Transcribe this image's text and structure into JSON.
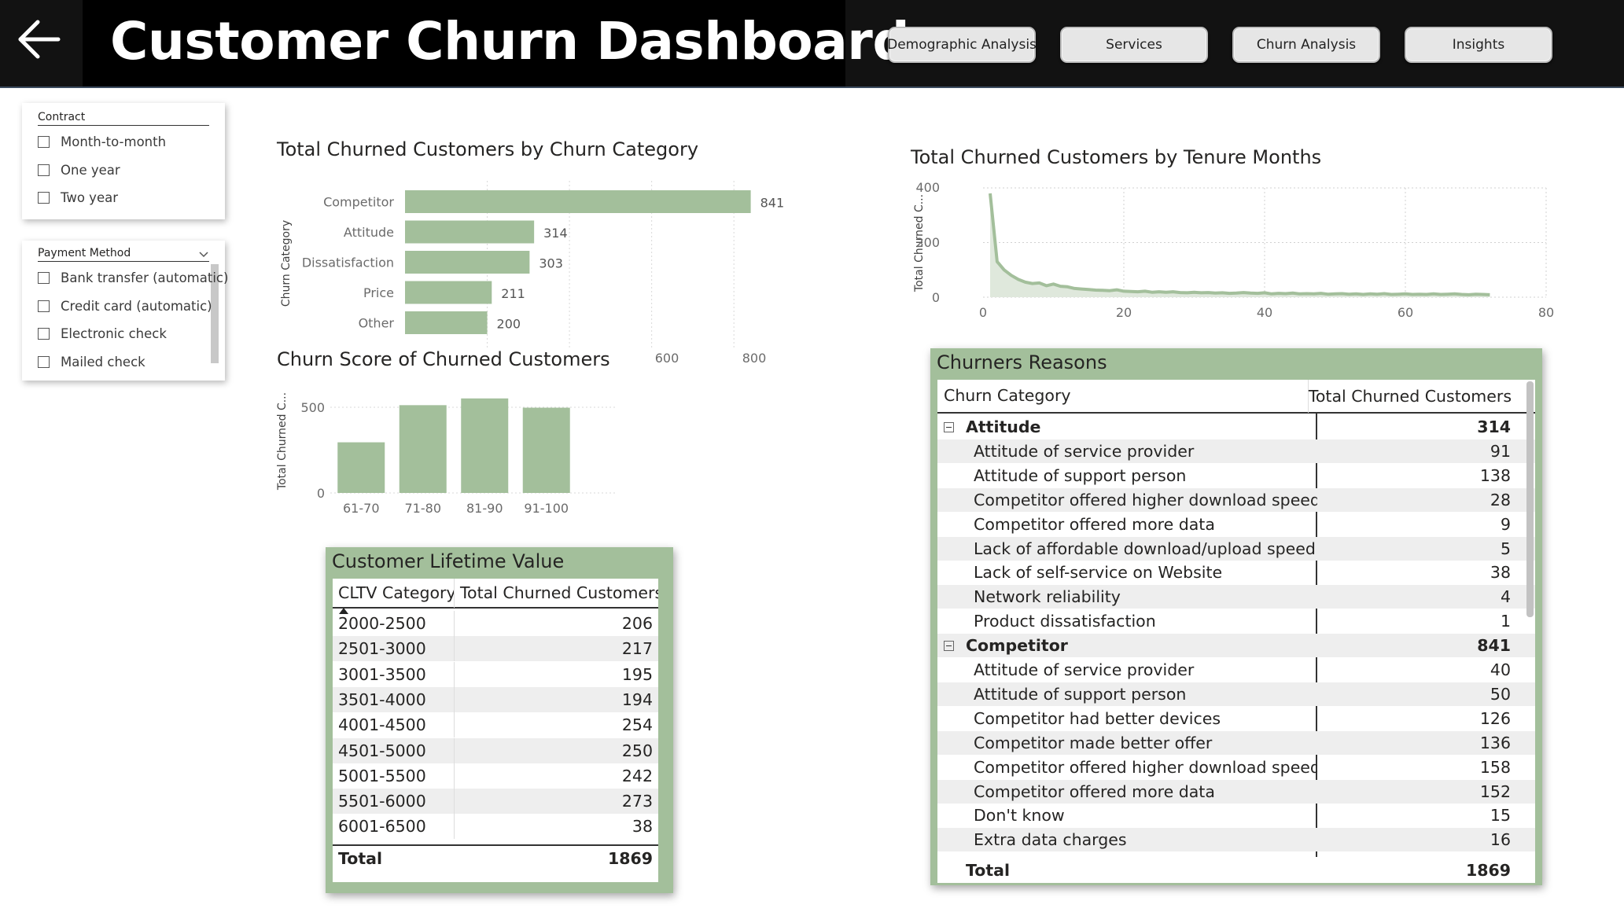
{
  "header": {
    "title": "Customer Churn Dashboard",
    "nav": [
      "Demographic Analysis",
      "Services",
      "Churn Analysis",
      "Insights"
    ]
  },
  "slicers": {
    "contract": {
      "title": "Contract",
      "options": [
        "Month-to-month",
        "One year",
        "Two year"
      ]
    },
    "payment": {
      "title": "Payment Method",
      "options": [
        "Bank transfer (automatic)",
        "Credit card (automatic)",
        "Electronic check",
        "Mailed check"
      ]
    }
  },
  "charts": {
    "category": {
      "title": "Total Churned Customers by Churn Category",
      "ylabel": "Churn Category",
      "xticks": [
        "600",
        "800"
      ]
    },
    "score": {
      "title": "Churn Score of Churned Customers",
      "ylabel": "Total Churned C...",
      "yticks": [
        "500",
        "0"
      ]
    },
    "tenure": {
      "title": "Total Churned Customers by Tenure Months",
      "ylabel": "Total Churned C...",
      "yticks": [
        "400",
        "200",
        "0"
      ],
      "xticks": [
        "0",
        "20",
        "40",
        "60",
        "80"
      ]
    }
  },
  "chart_data": [
    {
      "type": "bar",
      "orientation": "horizontal",
      "title": "Total Churned Customers by Churn Category",
      "ylabel": "Churn Category",
      "categories": [
        "Competitor",
        "Attitude",
        "Dissatisfaction",
        "Price",
        "Other"
      ],
      "values": [
        841,
        314,
        303,
        211,
        200
      ],
      "xlim": [
        0,
        880
      ],
      "grid": true,
      "color": "#a3bf9b"
    },
    {
      "type": "bar",
      "title": "Churn Score of Churned Customers",
      "ylabel": "Total Churned C...",
      "categories": [
        "61-70",
        "71-80",
        "81-90",
        "91-100"
      ],
      "values": [
        300,
        520,
        560,
        505
      ],
      "ylim": [
        0,
        600
      ],
      "color": "#a3bf9b"
    },
    {
      "type": "area",
      "title": "Total Churned Customers by Tenure Months",
      "xlabel": "",
      "ylabel": "Total Churned C...",
      "x": [
        1,
        2,
        3,
        4,
        5,
        6,
        7,
        8,
        9,
        10,
        11,
        12,
        13,
        14,
        15,
        16,
        17,
        18,
        19,
        20,
        21,
        22,
        23,
        24,
        25,
        26,
        27,
        28,
        29,
        30,
        31,
        32,
        33,
        34,
        35,
        36,
        37,
        38,
        39,
        40,
        41,
        42,
        43,
        44,
        45,
        46,
        47,
        48,
        49,
        50,
        51,
        52,
        53,
        54,
        55,
        56,
        57,
        58,
        59,
        60,
        61,
        62,
        63,
        64,
        65,
        66,
        67,
        68,
        69,
        70,
        71,
        72
      ],
      "y": [
        380,
        130,
        100,
        80,
        65,
        55,
        50,
        52,
        42,
        48,
        40,
        38,
        32,
        30,
        28,
        26,
        25,
        24,
        27,
        22,
        21,
        20,
        22,
        18,
        20,
        18,
        20,
        17,
        16,
        18,
        16,
        17,
        15,
        16,
        14,
        15,
        17,
        15,
        14,
        16,
        12,
        14,
        13,
        15,
        12,
        13,
        12,
        14,
        11,
        12,
        13,
        11,
        12,
        10,
        12,
        11,
        13,
        10,
        11,
        12,
        10,
        11,
        10,
        12,
        10,
        11,
        12,
        10,
        9,
        11,
        10,
        9
      ],
      "xlim": [
        0,
        80
      ],
      "ylim": [
        0,
        400
      ],
      "grid": true,
      "color": "#a3bf9b"
    }
  ],
  "cltv": {
    "title": "Customer Lifetime Value",
    "col1": "CLTV Category",
    "col2": "Total Churned Customers",
    "rows": [
      [
        "2000-2500",
        "206"
      ],
      [
        "2501-3000",
        "217"
      ],
      [
        "3001-3500",
        "195"
      ],
      [
        "3501-4000",
        "194"
      ],
      [
        "4001-4500",
        "254"
      ],
      [
        "4501-5000",
        "250"
      ],
      [
        "5001-5500",
        "242"
      ],
      [
        "5501-6000",
        "273"
      ],
      [
        "6001-6500",
        "38"
      ]
    ],
    "total_label": "Total",
    "total_value": "1869"
  },
  "reasons": {
    "title": "Churners Reasons",
    "col1": "Churn Category",
    "col2": "Total Churned Customers",
    "rows": [
      {
        "label": "Attitude",
        "value": "314",
        "group": true
      },
      {
        "label": "Attitude of service provider",
        "value": "91"
      },
      {
        "label": "Attitude of support person",
        "value": "138"
      },
      {
        "label": "Competitor offered higher download speeds",
        "value": "28"
      },
      {
        "label": "Competitor offered more data",
        "value": "9"
      },
      {
        "label": "Lack of affordable download/upload speed",
        "value": "5"
      },
      {
        "label": "Lack of self-service on Website",
        "value": "38"
      },
      {
        "label": "Network reliability",
        "value": "4"
      },
      {
        "label": "Product dissatisfaction",
        "value": "1"
      },
      {
        "label": "Competitor",
        "value": "841",
        "group": true
      },
      {
        "label": "Attitude of service provider",
        "value": "40"
      },
      {
        "label": "Attitude of support person",
        "value": "50"
      },
      {
        "label": "Competitor had better devices",
        "value": "126"
      },
      {
        "label": "Competitor made better offer",
        "value": "136"
      },
      {
        "label": "Competitor offered higher download speeds",
        "value": "158"
      },
      {
        "label": "Competitor offered more data",
        "value": "152"
      },
      {
        "label": "Don't know",
        "value": "15"
      },
      {
        "label": "Extra data charges",
        "value": "16"
      }
    ],
    "total_label": "Total",
    "total_value": "1869"
  }
}
